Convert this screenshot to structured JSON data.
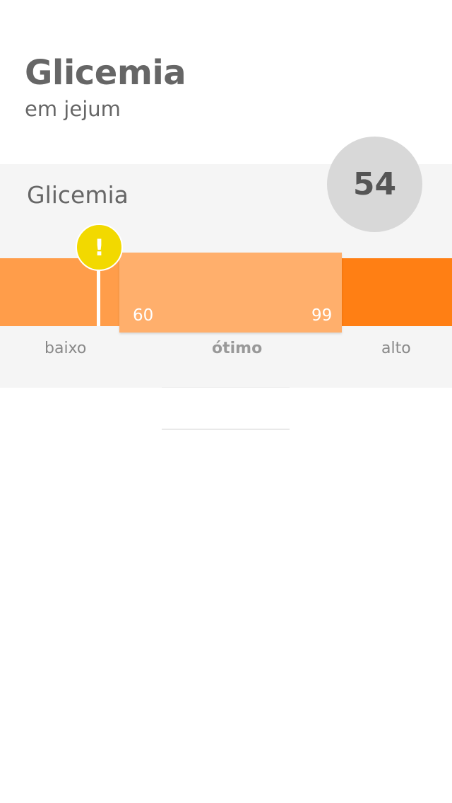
{
  "header": {
    "title": "Glicemia",
    "subtitle": "em jejum"
  },
  "measurement": {
    "label": "Glicemia",
    "value": "54",
    "alert_symbol": "!",
    "range": {
      "min": "60",
      "max": "99"
    },
    "zones": {
      "low": "baixo",
      "optimal": "ótimo",
      "high": "alto"
    },
    "colors": {
      "low": "#ff9d4a",
      "optimal": "#ffaf6c",
      "high": "#ff7f14",
      "alert": "#f2d900",
      "value_circle": "#d8d8d8"
    }
  }
}
